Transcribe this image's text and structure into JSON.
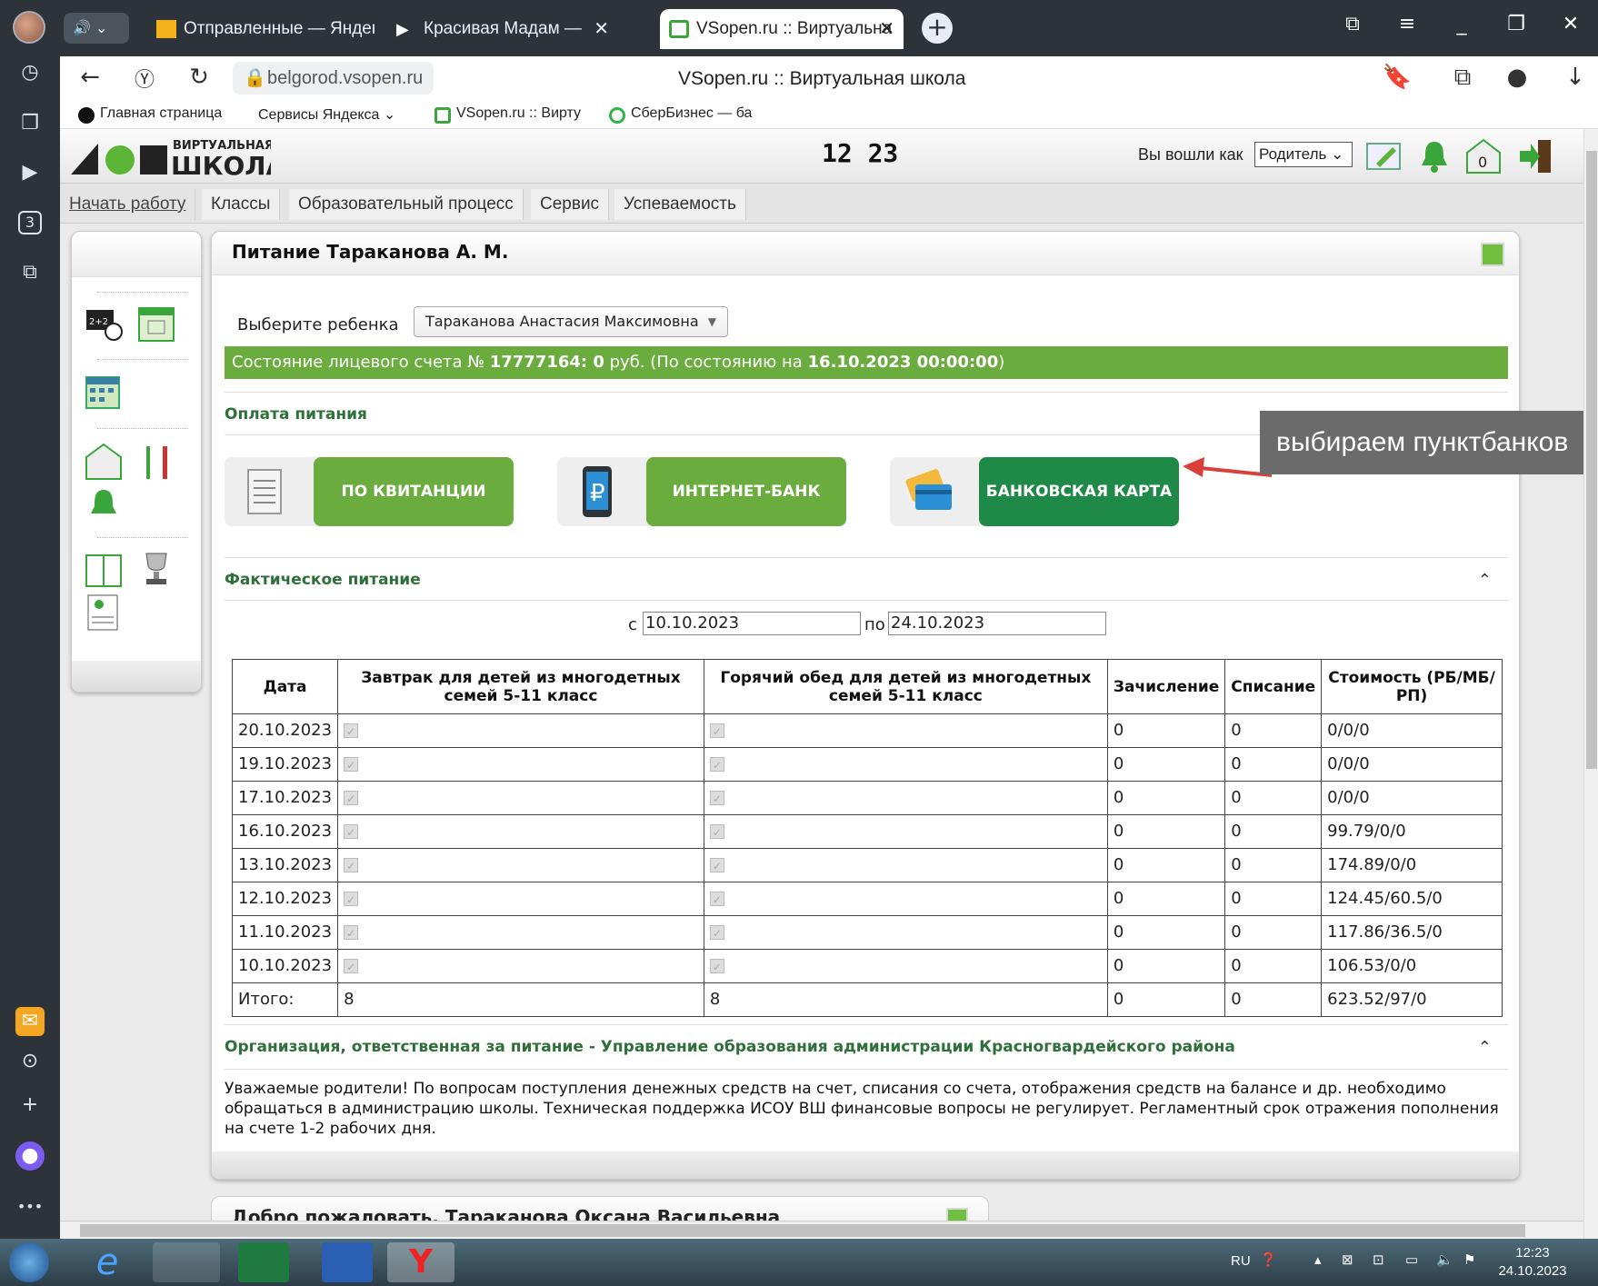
{
  "browser": {
    "tabs": [
      {
        "label": "Отправленные — Яндекс",
        "icon": "mail-icon"
      },
      {
        "label": "Красивая Мадам —",
        "icon": "play-icon"
      },
      {
        "label": "VSopen.ru :: Виртуальна",
        "icon": "vsopen-icon",
        "active": true
      }
    ],
    "url": "belgorod.vsopen.ru",
    "page_title": "VSopen.ru :: Виртуальная школа",
    "bookmarks": [
      "Главная страница",
      "Сервисы Яндекса",
      "VSopen.ru :: Вирту",
      "СберБизнес — ба"
    ]
  },
  "app": {
    "logo_top": "ВИРТУАЛЬНАЯ",
    "logo_bottom": "ШКОЛА",
    "clock": "12 23",
    "logged_in_label": "Вы вошли как",
    "role": "Родитель",
    "notif_count": "0",
    "menu": [
      "Начать работу",
      "Классы",
      "Образовательный процесс",
      "Сервис",
      "Успеваемость"
    ]
  },
  "panel": {
    "title": "Питание Тараканова А. М.",
    "child_label": "Выберите ребенка",
    "child_value": "Тараканова Анастасия Максимовна",
    "account_prefix": "Состояние лицевого счета № ",
    "account_number": "17777164: 0",
    "account_mid": " руб. (По состоянию на ",
    "account_date": "16.10.2023 00:00:00",
    "account_suffix": ")",
    "payment_section": "Оплата питания",
    "pay_receipt": "ПО КВИТАНЦИИ",
    "pay_internet": "ИНТЕРНЕТ-БАНК",
    "pay_card": "БАНКОВСКАЯ КАРТА",
    "tooltip": "выбираем пунктбанков",
    "actual_section": "Фактическое питание",
    "from_label": "с",
    "from_value": "10.10.2023",
    "to_label": "по",
    "to_value": "24.10.2023",
    "columns": [
      "Дата",
      "Завтрак для детей из многодетных семей 5-11 класс",
      "Горячий обед для детей из многодетных семей 5-11 класс",
      "Зачисление",
      "Списание",
      "Стоимость (РБ/МБ/РП)"
    ],
    "rows": [
      {
        "date": "20.10.2023",
        "in": "0",
        "out": "0",
        "cost": "0/0/0"
      },
      {
        "date": "19.10.2023",
        "in": "0",
        "out": "0",
        "cost": "0/0/0"
      },
      {
        "date": "17.10.2023",
        "in": "0",
        "out": "0",
        "cost": "0/0/0"
      },
      {
        "date": "16.10.2023",
        "in": "0",
        "out": "0",
        "cost": "99.79/0/0"
      },
      {
        "date": "13.10.2023",
        "in": "0",
        "out": "0",
        "cost": "174.89/0/0"
      },
      {
        "date": "12.10.2023",
        "in": "0",
        "out": "0",
        "cost": "124.45/60.5/0"
      },
      {
        "date": "11.10.2023",
        "in": "0",
        "out": "0",
        "cost": "117.86/36.5/0"
      },
      {
        "date": "10.10.2023",
        "in": "0",
        "out": "0",
        "cost": "106.53/0/0"
      }
    ],
    "total": {
      "label": "Итого:",
      "breakfast": "8",
      "lunch": "8",
      "in": "0",
      "out": "0",
      "cost": "623.52/97/0"
    },
    "org_section": "Организация, ответственная за питание - Управление образования администрации Красногвардейского района",
    "notice": "Уважаемые родители! По вопросам поступления денежных средств на счет, списания со счета, отображения средств на балансе и др. необходимо обращаться в администрацию школы. Техническая поддержка ИСОУ ВШ финансовые вопросы не регулирует. Регламентный срок отражения пополнения на счете 1-2 рабочих дня."
  },
  "panel2": {
    "title": "Добро пожаловать, Тараканова Оксана Васильевна"
  },
  "taskbar": {
    "lang": "RU",
    "time": "12:23",
    "date": "24.10.2023"
  },
  "colors": {
    "green": "#6aac3e",
    "dark_green": "#1f8a48",
    "title_green": "#2f6f3a",
    "browser_dark": "#2d3339"
  }
}
